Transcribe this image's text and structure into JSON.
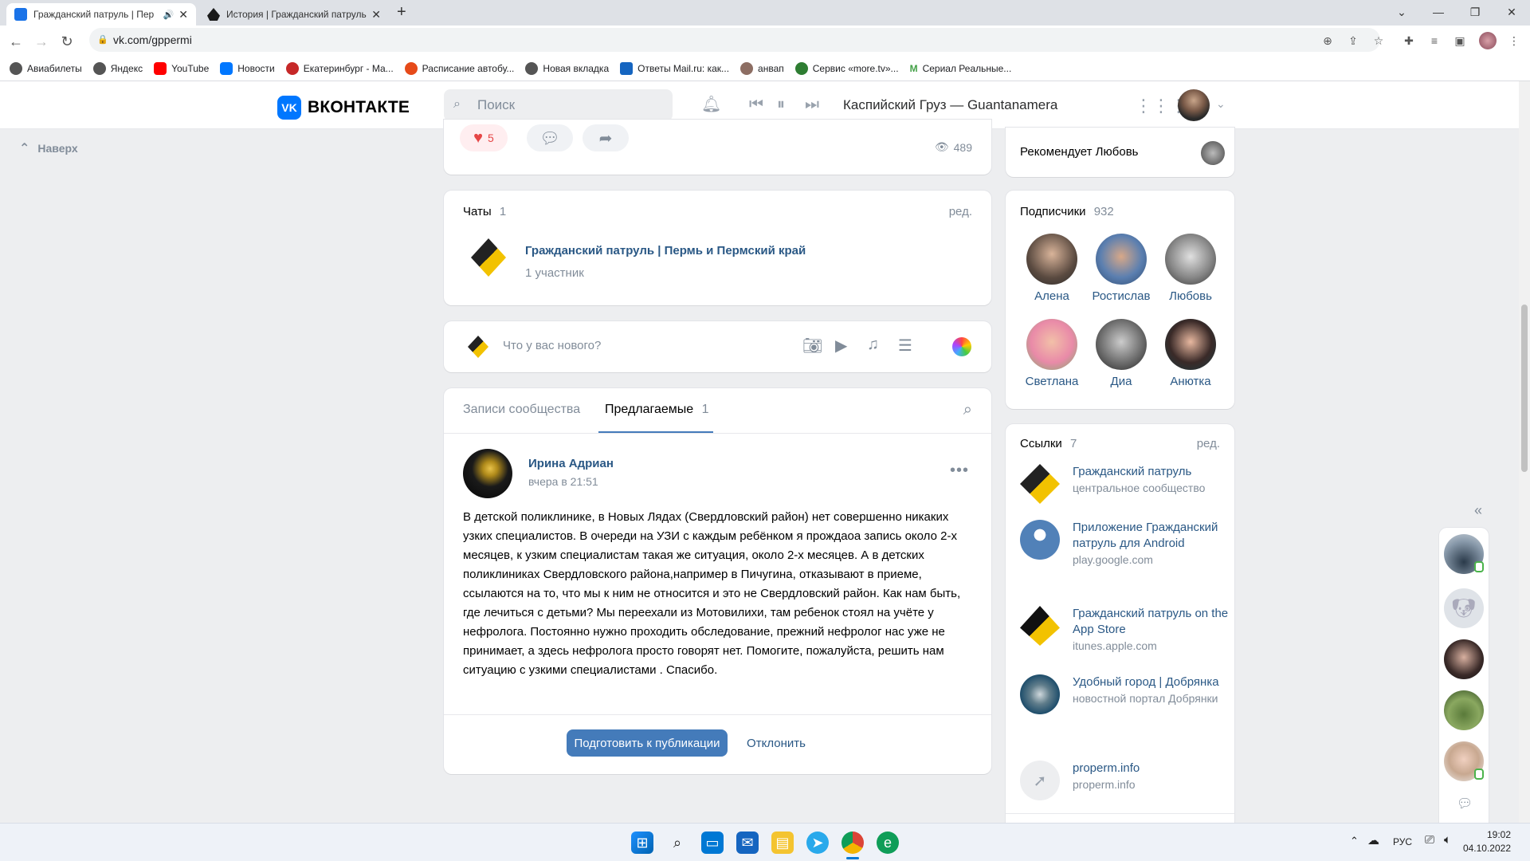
{
  "browser": {
    "tabs": [
      {
        "title": "Гражданский патруль | Пер",
        "active": true
      },
      {
        "title": "История | Гражданский патруль",
        "active": false
      }
    ],
    "new_tab": "+",
    "url": "vk.com/gppermi",
    "bookmarks": [
      "Авиабилеты",
      "Яндекс",
      "YouTube",
      "Новости",
      "Екатеринбург - Ма...",
      "Расписание автобу...",
      "Новая вкладка",
      "Ответы Mail.ru: как...",
      "анвап",
      "Сервис «more.tv»...",
      "Сериал Реальные..."
    ]
  },
  "vk_header": {
    "logo_text": "ВКОНТАКТЕ",
    "logo_mark": "VK",
    "search_placeholder": "Поиск",
    "now_playing": "Каспийский Груз — Guantanamera"
  },
  "left_nav": {
    "up_label": "Наверх"
  },
  "post_actions": {
    "likes": "5",
    "views": "489"
  },
  "chats": {
    "title": "Чаты",
    "count": "1",
    "edit": "ред.",
    "chat_name": "Гражданский патруль | Пермь и Пермский край",
    "members": "1 участник"
  },
  "composer": {
    "placeholder": "Что у вас нового?"
  },
  "wall": {
    "tabs": [
      {
        "label": "Записи сообщества",
        "count": ""
      },
      {
        "label": "Предлагаемые",
        "count": "1"
      }
    ],
    "active_tab": 1,
    "post": {
      "author": "Ирина Адриан",
      "time": "вчера в 21:51",
      "text": "В детской поликлинике, в Новых Лядах (Свердловский район) нет совершенно никаких узких специалистов. В очереди на УЗИ с каждым ребёнком я прождаоа запись около 2-х месяцев, к узким специалистам такая же ситуация, около 2-х месяцев. А в детских поликлиниках Свердловского района,например в Пичугина, отказывают в приеме, ссылаются на то, что мы к ним не относится и это не Свердловский район. Как нам быть, где лечиться с детьми? Мы переехали из Мотовилихи, там ребенок стоял на учёте у нефролога. Постоянно нужно проходить обследование, прежний нефролог нас уже не принимает, а здесь нефролога просто говорят нет. Помогите, пожалуйста, решить нам ситуацию с узкими специалистами . Спасибо.",
      "publish_button": "Подготовить к публикации",
      "reject_button": "Отклонить"
    }
  },
  "recommend": {
    "label": "Рекомендует Любовь"
  },
  "subscribers": {
    "title": "Подписчики",
    "count": "932",
    "people": [
      "Алена",
      "Ростислав",
      "Любовь",
      "Светлана",
      "Диа",
      "Анютка"
    ]
  },
  "links": {
    "title": "Ссылки",
    "count": "7",
    "edit": "ред.",
    "items": [
      {
        "title": "Гражданский патруль",
        "sub": "центральное сообщество"
      },
      {
        "title": "Приложение Гражданский патруль для Android",
        "sub": "play.google.com"
      },
      {
        "title": "Гражданский патруль on the App Store",
        "sub": "itunes.apple.com"
      },
      {
        "title": "Удобный город | Добрянка",
        "sub": "новостной портал Добрянки"
      },
      {
        "title": "properm.info",
        "sub": "properm.info"
      }
    ]
  },
  "taskbar": {
    "lang": "РУС",
    "time": "19:02",
    "date": "04.10.2022"
  },
  "colors": {
    "vk_blue": "#0077ff",
    "button_blue": "#447bba",
    "link": "#2a5885",
    "muted": "#818c99"
  }
}
